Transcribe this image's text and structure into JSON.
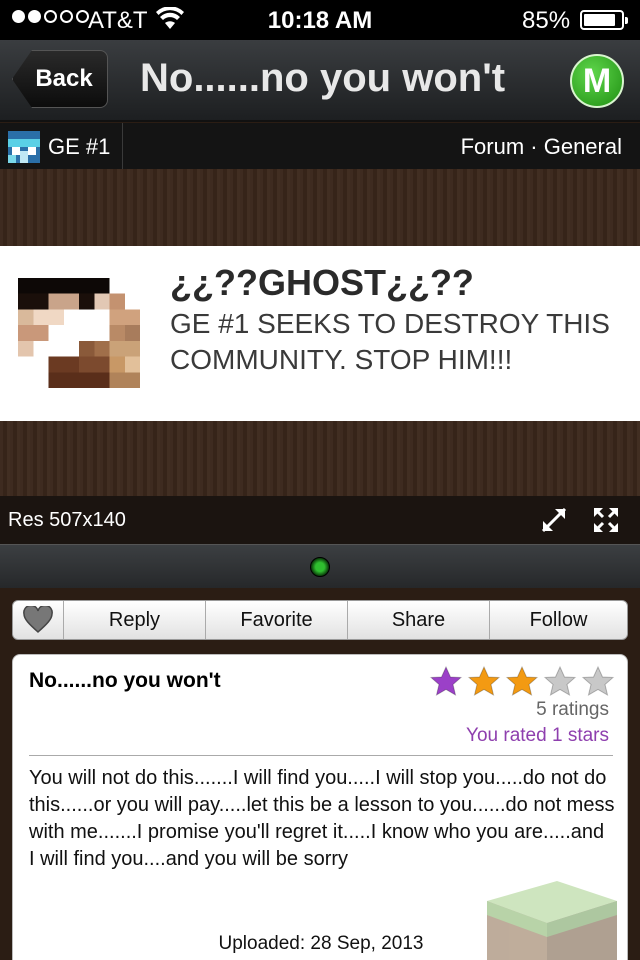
{
  "status": {
    "carrier": "AT&T",
    "time": "10:18 AM",
    "battery": "85%",
    "battery_fraction": 0.85,
    "signal_bars": 2
  },
  "nav": {
    "back_label": "Back",
    "title": "No......no you won't",
    "logo_letter": "M"
  },
  "forum": {
    "author": "GE #1",
    "location": "Forum · General"
  },
  "image": {
    "heading": "¿¿??GHOST¿¿??",
    "line1": "GE #1 SEEKS TO DESTROY THIS",
    "line2": "COMMUNITY. STOP HIM!!!"
  },
  "resolution": "Res 507x140",
  "toolbar": {
    "reply": "Reply",
    "favorite": "Favorite",
    "share": "Share",
    "follow": "Follow"
  },
  "post": {
    "title": "No......no you won't",
    "rating_stars": 3,
    "ratings_count": "5 ratings",
    "user_rating": "You rated 1 stars",
    "body": "You will not do this.......I will find you.....I will stop you.....do not do this......or you will pay.....let this be a lesson to you......do not mess with me.......I promise you'll regret it.....I know who you are.....and I will find you....and you will be sorry",
    "uploaded": "Uploaded: 28 Sep, 2013"
  },
  "colors": {
    "star_purple": "#9b40c8",
    "star_orange": "#f39a12",
    "star_empty": "#c8c8c8",
    "rated_text": "#8e3fae",
    "logo_green": "#2fa51d"
  },
  "icons": [
    "wifi-icon",
    "battery-icon",
    "heart-icon",
    "expand-icon",
    "fullscreen-icon",
    "star-icon"
  ]
}
